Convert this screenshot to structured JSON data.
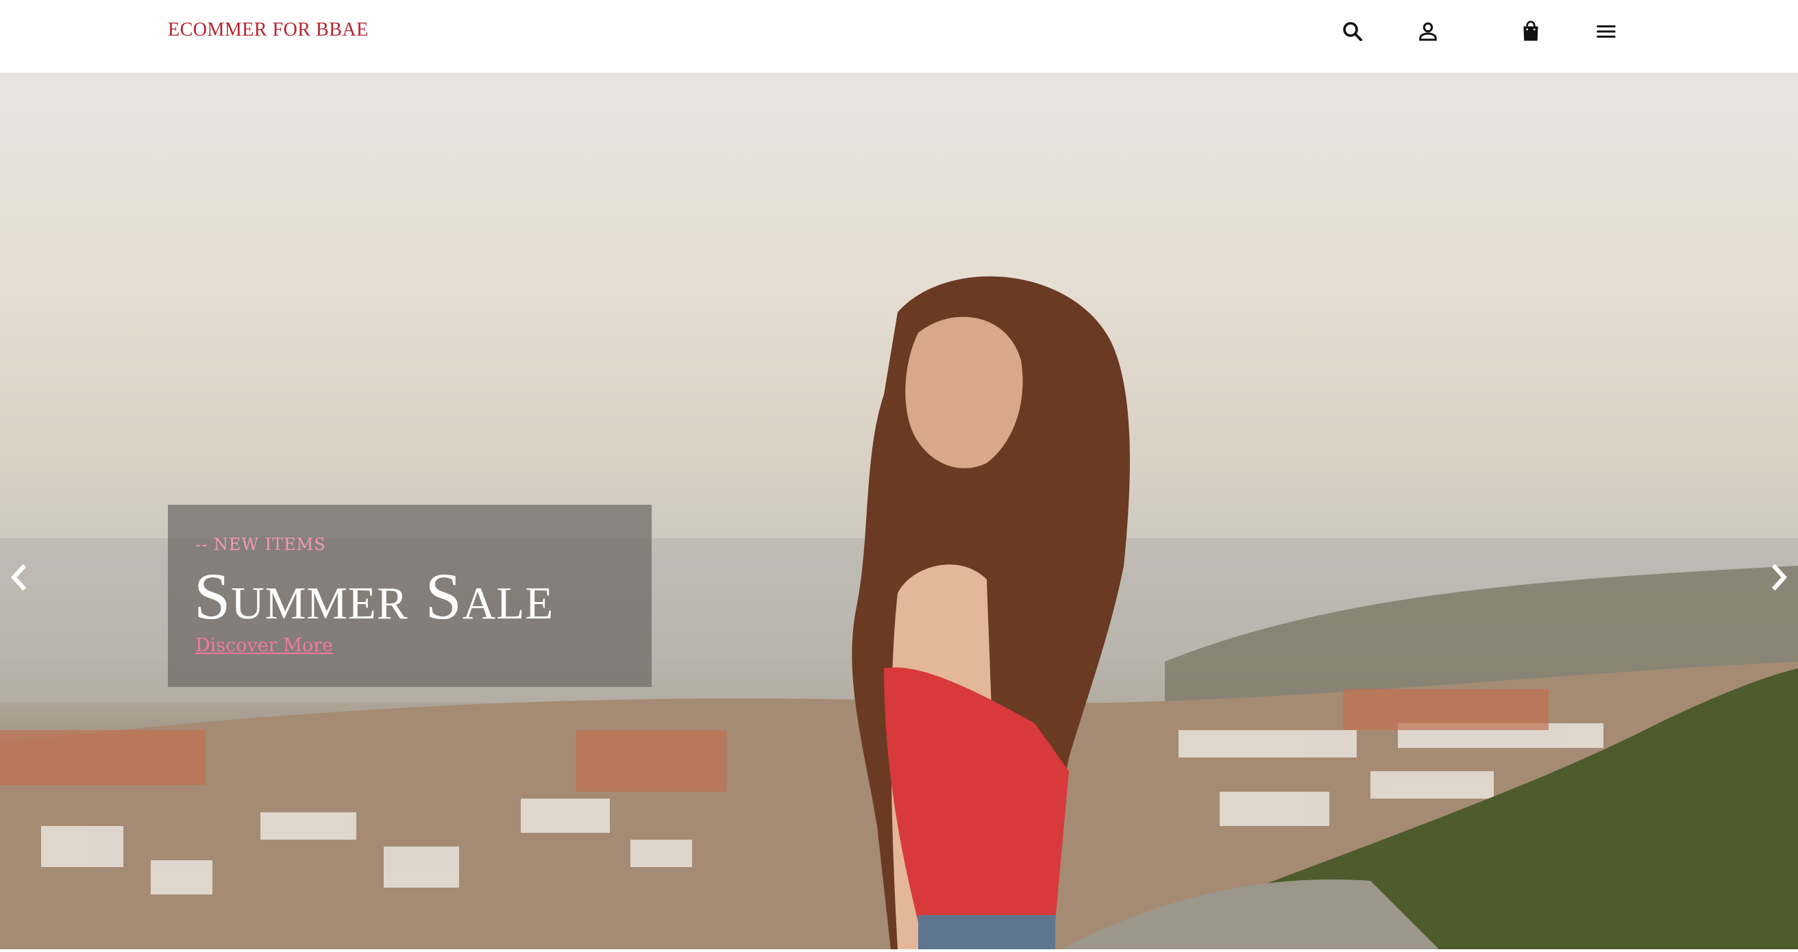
{
  "header": {
    "logo": "ECOMMER FOR BBAE",
    "icons": [
      "search-icon",
      "user-icon",
      "shopping-bag-icon",
      "menu-icon"
    ]
  },
  "hero": {
    "eyebrow": "-- NEW ITEMS",
    "headline": "Summer Sale",
    "cta": "Discover More"
  },
  "colors": {
    "brand": "#b8232f",
    "eyebrow": "#f39ab2",
    "cta": "#f17aa0",
    "caption_bg": "#6e6864"
  }
}
